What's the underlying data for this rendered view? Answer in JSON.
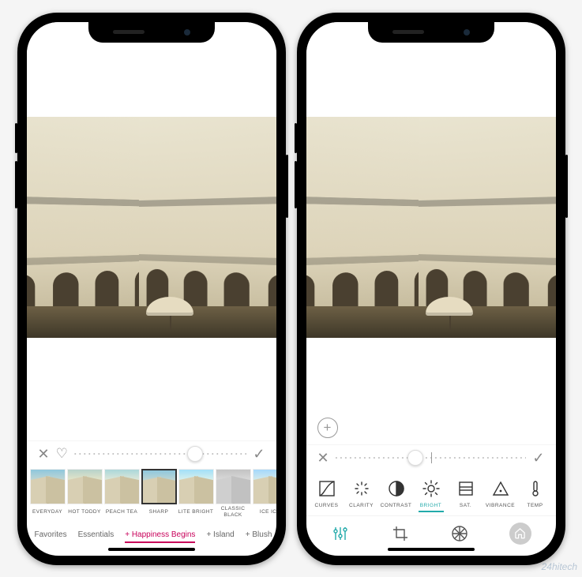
{
  "left": {
    "slider": {
      "position_pct": 70
    },
    "filters": [
      {
        "label": "EVERYDAY",
        "tone": "f-ev",
        "selected": false
      },
      {
        "label": "HOT TODDY",
        "tone": "f-ht",
        "selected": false
      },
      {
        "label": "PEACH TEA",
        "tone": "f-pt",
        "selected": false
      },
      {
        "label": "SHARP",
        "tone": "f-sh",
        "selected": true
      },
      {
        "label": "LITE BRIGHT",
        "tone": "f-lb",
        "selected": false
      },
      {
        "label": "CLASSIC BLACK",
        "tone": "f-cb",
        "selected": false
      },
      {
        "label": "ICE ICE",
        "tone": "f-ii",
        "selected": false
      }
    ],
    "collections": [
      {
        "label": "Favorites",
        "active": false
      },
      {
        "label": "Essentials",
        "active": false
      },
      {
        "label": "+ Happiness Begins",
        "active": true
      },
      {
        "label": "+ Island",
        "active": false
      },
      {
        "label": "+ Blush",
        "active": false
      }
    ]
  },
  "right": {
    "plus_visible": true,
    "slider": {
      "position_pct": 42
    },
    "adjustments": [
      {
        "label": "CURVES",
        "icon": "curves",
        "active": false
      },
      {
        "label": "CLARITY",
        "icon": "clarity",
        "active": false
      },
      {
        "label": "CONTRAST",
        "icon": "contrast",
        "active": false
      },
      {
        "label": "BRIGHT",
        "icon": "bright",
        "active": true
      },
      {
        "label": "SAT.",
        "icon": "sat",
        "active": false
      },
      {
        "label": "VIBRANCE",
        "icon": "vibrance",
        "active": false
      },
      {
        "label": "TEMP",
        "icon": "temp",
        "active": false
      }
    ],
    "tabs": [
      {
        "icon": "sliders",
        "active": true
      },
      {
        "icon": "crop",
        "active": false
      },
      {
        "icon": "wheel",
        "active": false
      }
    ]
  },
  "icons": {
    "close": "✕",
    "heart": "♡",
    "check": "✓",
    "plus": "+"
  },
  "watermark": "24hitech"
}
